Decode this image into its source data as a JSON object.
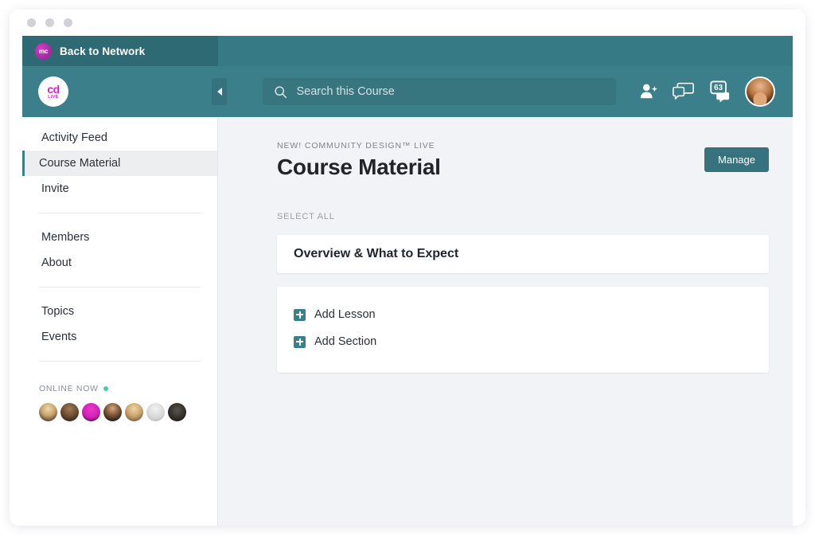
{
  "window": {
    "dots": [
      "close",
      "minimize",
      "maximize"
    ]
  },
  "topstrip": {
    "badge_text": "mc",
    "back_label": "Back to Network"
  },
  "navbar": {
    "logo": {
      "primary": "cd",
      "secondary": "LIVE"
    },
    "collapse_icon": "chevron-left-icon",
    "search": {
      "placeholder": "Search this Course",
      "value": "",
      "icon": "search-icon"
    },
    "icons": [
      {
        "name": "add-person-icon"
      },
      {
        "name": "chat-bubbles-icon"
      },
      {
        "name": "notifications-icon",
        "badge": "63"
      }
    ],
    "avatar": "user-avatar"
  },
  "sidebar": {
    "groups": [
      {
        "items": [
          {
            "label": "Activity Feed",
            "active": false
          },
          {
            "label": "Course Material",
            "active": true
          },
          {
            "label": "Invite",
            "active": false
          }
        ]
      },
      {
        "items": [
          {
            "label": "Members",
            "active": false
          },
          {
            "label": "About",
            "active": false
          }
        ]
      },
      {
        "items": [
          {
            "label": "Topics",
            "active": false
          },
          {
            "label": "Events",
            "active": false
          }
        ]
      }
    ],
    "online": {
      "label": "ONLINE NOW",
      "status_color": "#38d39f",
      "avatars": [
        {
          "name": "member-avatar-1",
          "color": "radial-gradient(circle at 50% 32%, #efd9ad 0%, #c9a46b 45%, #4a3a24 85%)"
        },
        {
          "name": "member-avatar-2",
          "color": "radial-gradient(circle at 50% 32%, #9d7c56 0%, #6b4d30 50%, #2a1d12 90%)"
        },
        {
          "name": "member-avatar-3",
          "color": "radial-gradient(circle at 50% 35%, #e83bc8 0%, #d41eb8 55%, #1d1020 95%)"
        },
        {
          "name": "member-avatar-4",
          "color": "radial-gradient(circle at 50% 30%, #d6a87c 0%, #7a5436 45%, #181210 88%)"
        },
        {
          "name": "member-avatar-5",
          "color": "radial-gradient(circle at 50% 32%, #f0d6a6 0%, #cba36c 48%, #6b4e2e 92%)"
        },
        {
          "name": "member-avatar-6",
          "color": "radial-gradient(circle at 50% 32%, #f2f2f2 0%, #d8d8d8 55%, #b4b4b4 95%)"
        },
        {
          "name": "member-avatar-more",
          "color": "radial-gradient(circle at 50% 40%, #5a5550 0%, #2e2a26 60%, #14110f 95%)"
        }
      ]
    }
  },
  "main": {
    "eyebrow": "NEW! COMMUNITY DESIGN™ LIVE",
    "title": "Course Material",
    "manage_label": "Manage",
    "select_all_label": "SELECT ALL",
    "overview_card": {
      "title": "Overview & What to Expect"
    },
    "actions": [
      {
        "label": "Add Lesson",
        "icon": "plus-square-icon"
      },
      {
        "label": "Add Section",
        "icon": "plus-square-icon"
      }
    ]
  },
  "colors": {
    "teal_dark": "#2d6a74",
    "teal": "#3b7f8a",
    "magenta": "#d41ec8",
    "page_bg": "#f2f3f7",
    "online_green": "#38d39f"
  }
}
